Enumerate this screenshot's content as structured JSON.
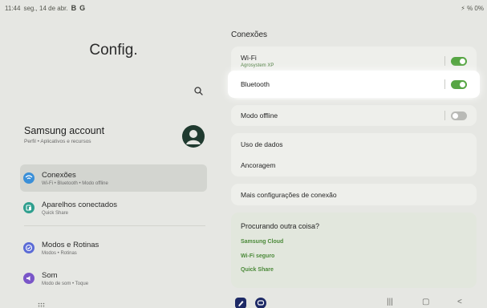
{
  "status_bar": {
    "time": "11:44",
    "date": "seg., 14 de abr.",
    "left_icons": [
      "B",
      "G"
    ],
    "right_text": "⚡ % 0%"
  },
  "left": {
    "title": "Config.",
    "account": {
      "name": "Samsung account",
      "subtitle": "Perfil  •  Aplicativos e recursos"
    },
    "nav": [
      {
        "label": "Conexões",
        "sub": "Wi-Fi  •  Bluetooth  •  Modo offline",
        "color": "#3a8fd8",
        "selected": true
      },
      {
        "label": "Aparelhos conectados",
        "sub": "Quick Share",
        "color": "#2f9f8e",
        "selected": false
      },
      {
        "label": "Modos e Rotinas",
        "sub": "Modos  •  Rotinas",
        "color": "#5b6bd6",
        "selected": false
      },
      {
        "label": "Som",
        "sub": "Modo de som  •  Toque",
        "color": "#7a56c8",
        "selected": false
      }
    ]
  },
  "right": {
    "title": "Conexões",
    "wifi": {
      "label": "Wi-Fi",
      "sub": "Agrosystem XP",
      "on": true
    },
    "bluetooth": {
      "label": "Bluetooth",
      "on": true
    },
    "offline": {
      "label": "Modo offline",
      "on": false
    },
    "data_usage": "Uso de dados",
    "tethering": "Ancoragem",
    "more_connections": "Mais configurações de conexão",
    "suggestions": {
      "title": "Procurando outra coisa?",
      "links": [
        "Samsung Cloud",
        "Wi-Fi seguro",
        "Quick Share"
      ]
    }
  },
  "taskbar": {
    "nav_buttons": [
      "|||",
      "▢",
      "<"
    ]
  },
  "colors": {
    "accent_green": "#57a644",
    "background": "#e6e7e3",
    "card": "#eeefeb"
  }
}
